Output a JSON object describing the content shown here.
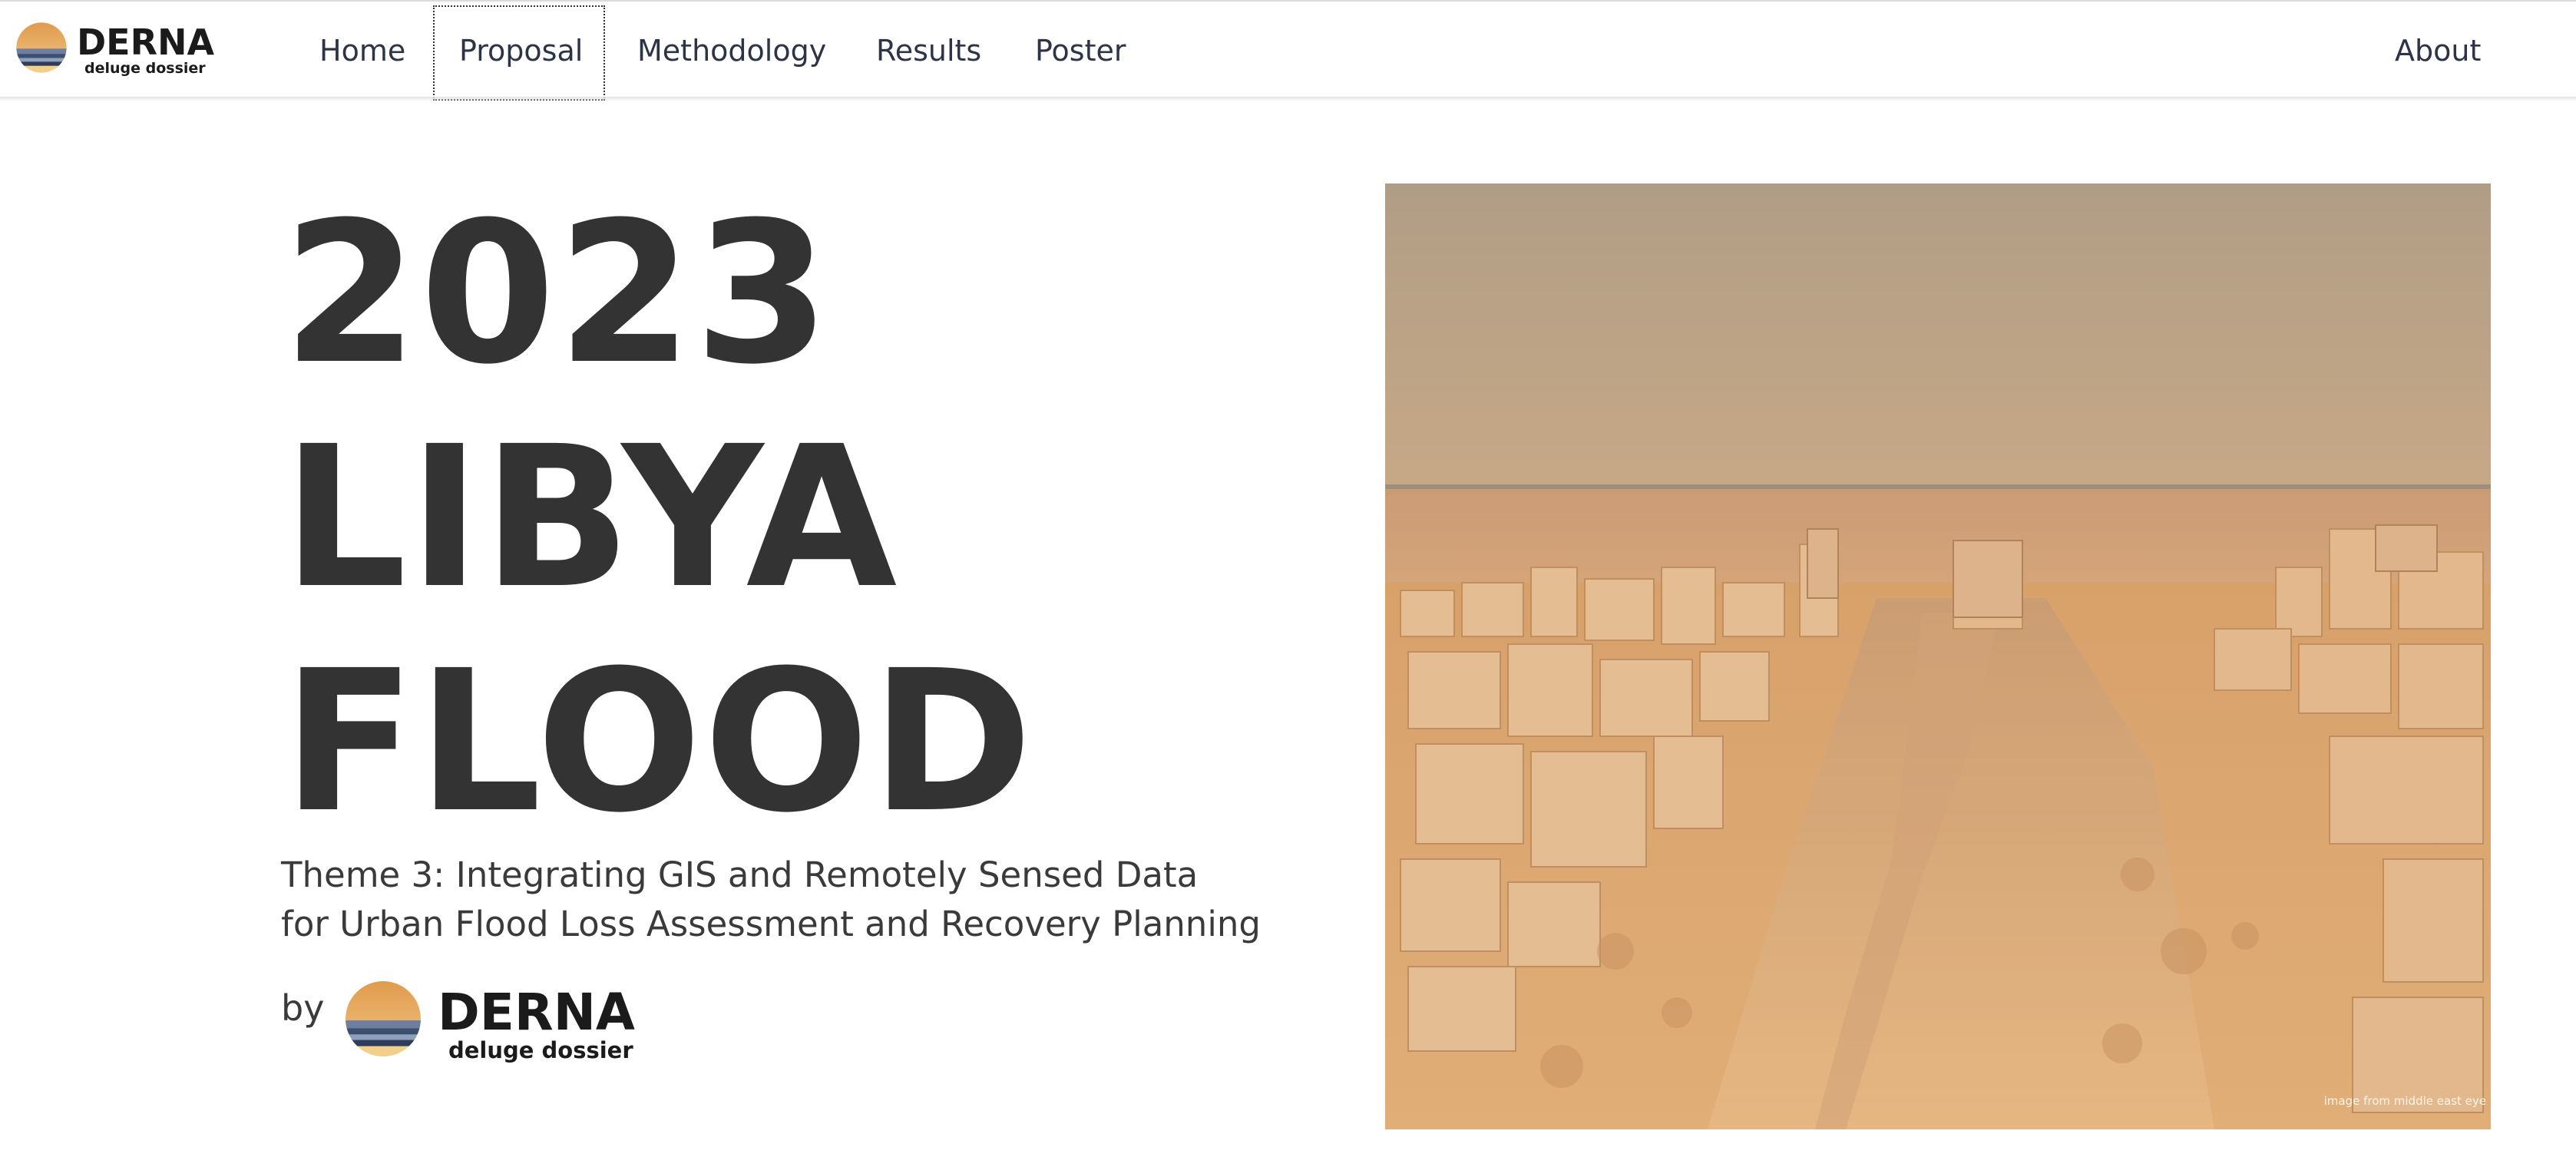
{
  "brand": {
    "title": "DERNA",
    "subtitle": "deluge dossier"
  },
  "nav": {
    "items": [
      {
        "label": "Home"
      },
      {
        "label": "Proposal"
      },
      {
        "label": "Methodology"
      },
      {
        "label": "Results"
      },
      {
        "label": "Poster"
      }
    ],
    "right_item": {
      "label": "About"
    },
    "active": "Proposal"
  },
  "hero": {
    "title_lines": [
      "2023",
      "LIBYA",
      "FLOOD"
    ],
    "subtitle_lines": [
      "Theme 3: Integrating GIS and Remotely Sensed Data",
      "for Urban Flood Loss Assessment and Recovery Planning"
    ],
    "by_label": "by",
    "byline_brand": {
      "title": "DERNA",
      "subtitle": "deluge dossier"
    }
  },
  "photo": {
    "credit": "image from middle east eye"
  },
  "colors": {
    "text": "#323232",
    "nav_text": "#2d3446",
    "logo_sun": "#e2a95a",
    "logo_water": "#3b4f73",
    "photo_tone": "#d9a66b"
  }
}
